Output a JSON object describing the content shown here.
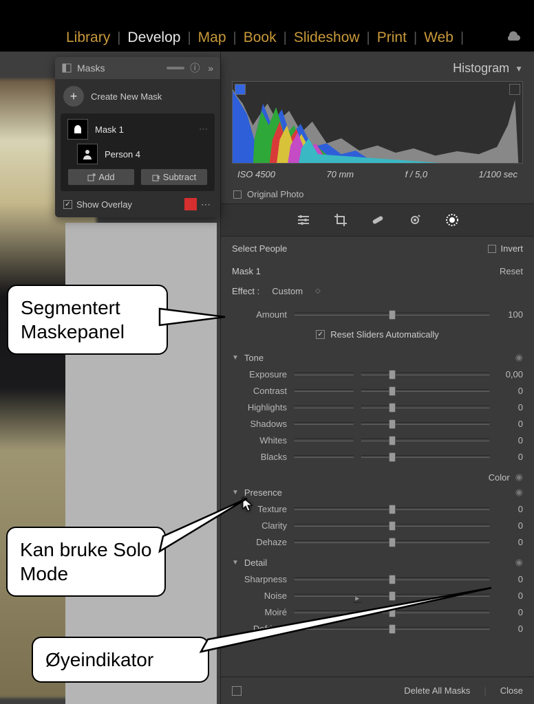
{
  "modules": {
    "library": "Library",
    "develop": "Develop",
    "map": "Map",
    "book": "Book",
    "slideshow": "Slideshow",
    "print": "Print",
    "web": "Web"
  },
  "masks_panel": {
    "title": "Masks",
    "create_new": "Create New Mask",
    "mask1_label": "Mask 1",
    "person_label": "Person 4",
    "add_btn": "Add",
    "subtract_btn": "Subtract",
    "show_overlay": "Show Overlay"
  },
  "histogram": {
    "title": "Histogram",
    "iso": "ISO 4500",
    "focal": "70 mm",
    "aperture": "f / 5,0",
    "shutter": "1/100 sec",
    "original": "Original Photo"
  },
  "mask_controls": {
    "select_people": "Select People",
    "invert": "Invert",
    "mask_name": "Mask 1",
    "reset": "Reset",
    "effect_label": "Effect :",
    "effect_value": "Custom",
    "amount_label": "Amount",
    "amount_value": "100",
    "reset_auto": "Reset Sliders Automatically"
  },
  "sections": {
    "tone": "Tone",
    "color": "Color",
    "presence": "Presence",
    "detail": "Detail"
  },
  "sliders": {
    "exposure": {
      "label": "Exposure",
      "value": "0,00"
    },
    "contrast": {
      "label": "Contrast",
      "value": "0"
    },
    "highlights": {
      "label": "Highlights",
      "value": "0"
    },
    "shadows": {
      "label": "Shadows",
      "value": "0"
    },
    "whites": {
      "label": "Whites",
      "value": "0"
    },
    "blacks": {
      "label": "Blacks",
      "value": "0"
    },
    "texture": {
      "label": "Texture",
      "value": "0"
    },
    "clarity": {
      "label": "Clarity",
      "value": "0"
    },
    "dehaze": {
      "label": "Dehaze",
      "value": "0"
    },
    "sharpness": {
      "label": "Sharpness",
      "value": "0"
    },
    "noise": {
      "label": "Noise",
      "value": "0"
    },
    "moire": {
      "label": "Moiré",
      "value": "0"
    },
    "defringe": {
      "label": "Defringe",
      "value": "0"
    }
  },
  "footer": {
    "delete_all": "Delete All Masks",
    "close": "Close"
  },
  "callouts": {
    "c1": "Segmentert Maskepanel",
    "c2": "Kan bruke Solo Mode",
    "c3": "Øyeindikator"
  }
}
